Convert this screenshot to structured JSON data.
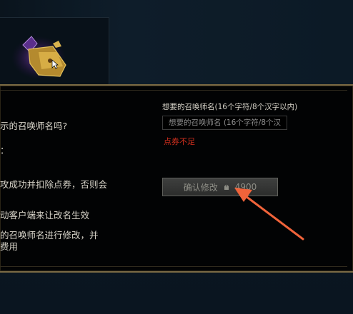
{
  "colors": {
    "error": "#d3301e",
    "arrow": "#f0633a",
    "modal_border": "#7a6a44",
    "button_bg": "#3a3b3a"
  },
  "modal": {
    "left_lines": [
      "示的召唤师名吗?",
      "：",
      "攻成功并扣除点券，否则会",
      "动客户端来让改名生效",
      "的召唤师名进行修改，并",
      "费用"
    ],
    "name_label": "想要的召唤师名(16个字符/8个汉字以内)",
    "name_input": {
      "value": "",
      "placeholder": "想要的召唤师名 (16个字符/8个汉"
    },
    "error_text": "点券不足",
    "confirm_button": {
      "label": "确认修改",
      "price": "4900",
      "currency_icon": "rp-coin-icon"
    }
  }
}
